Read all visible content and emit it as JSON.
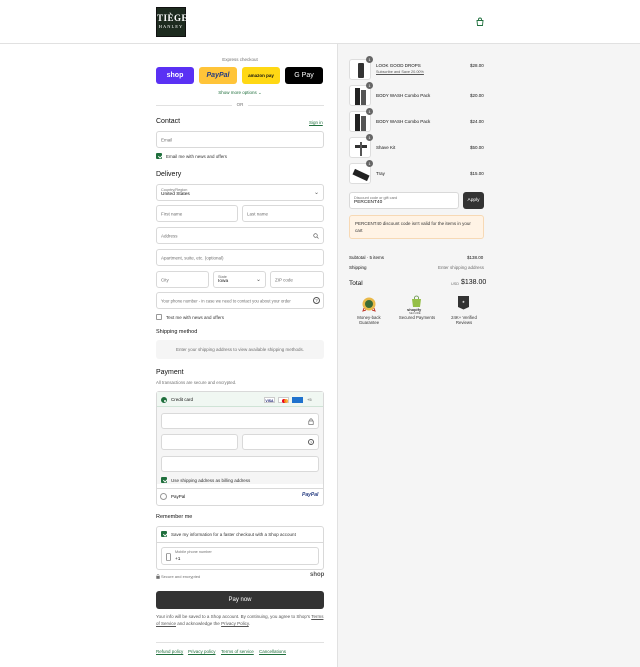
{
  "brand": {
    "line1": "TIÈGE",
    "line2": "HANLEY"
  },
  "express": {
    "label": "Express checkout",
    "shop": "shop",
    "paypal": "PayPal",
    "amazon": "amazon pay",
    "gpay": "G Pay",
    "more": "Show more options",
    "or": "OR"
  },
  "contact": {
    "title": "Contact",
    "signin": "Sign in",
    "email_placeholder": "Email",
    "news_label": "Email me with news and offers"
  },
  "delivery": {
    "title": "Delivery",
    "country_label": "Country/Region",
    "country_value": "United States",
    "first": "First name",
    "last": "Last name",
    "address": "Address",
    "apt": "Apartment, suite, etc. (optional)",
    "city": "City",
    "state_label": "State",
    "state_value": "Iowa",
    "zip": "ZIP code",
    "phone": "Your phone number - in case we need to contact you about your order",
    "text_label": "Text me with news and offers"
  },
  "shipping": {
    "title": "Shipping method",
    "message": "Enter your shipping address to view available shipping methods."
  },
  "payment": {
    "title": "Payment",
    "subtitle": "All transactions are secure and encrypted.",
    "credit": "Credit card",
    "card_more": "+5",
    "billing_label": "Use shipping address as billing address",
    "paypal": "PayPal",
    "paypal_logo": "PayPal"
  },
  "remember": {
    "title": "Remember me",
    "save_label": "Save my information for a faster checkout with a Shop account",
    "mobile_label": "Mobile phone number",
    "mobile_value": "+1",
    "secure": "Secure and encrypted",
    "shop": "shop"
  },
  "paynow": "Pay now",
  "legal": {
    "line1": "Your info will be saved to a Shop account. By continuing, you agree to Shop's",
    "tos": "Terms of Service",
    "and": "and acknowledge the",
    "privacy": "Privacy Policy",
    "period": "."
  },
  "footer": [
    "Refund policy",
    "Privacy policy",
    "Terms of service",
    "Cancellations"
  ],
  "cart": {
    "items": [
      {
        "name": "LOOK GOOD DROPS",
        "sub": "Subscribe and Save 20.00%",
        "qty": "1",
        "price": "$28.00"
      },
      {
        "name": "BODY WASH Combo Pack",
        "sub": "",
        "qty": "1",
        "price": "$20.00"
      },
      {
        "name": "BODY WASH Combo Pack",
        "sub": "",
        "qty": "1",
        "price": "$24.00"
      },
      {
        "name": "Shave Kit",
        "sub": "",
        "qty": "1",
        "price": "$50.00"
      },
      {
        "name": "Tray",
        "sub": "",
        "qty": "1",
        "price": "$15.00"
      }
    ],
    "discount_label": "Discount code or gift card",
    "discount_value": "PERCENT40",
    "apply": "Apply",
    "error": "PERCENT40 discount code isn't valid for the items in your cart",
    "subtotal_label": "Subtotal · 5 items",
    "subtotal": "$138.00",
    "shipping_label": "Shipping",
    "shipping_value": "Enter shipping address",
    "total_label": "Total",
    "currency": "USD",
    "total": "$138.00",
    "trust": [
      "Money-back Guarantee",
      "Secured Payments",
      "24K+ Verified Reviews"
    ],
    "shopify": "shopify",
    "secure_tag": "SECURE"
  }
}
